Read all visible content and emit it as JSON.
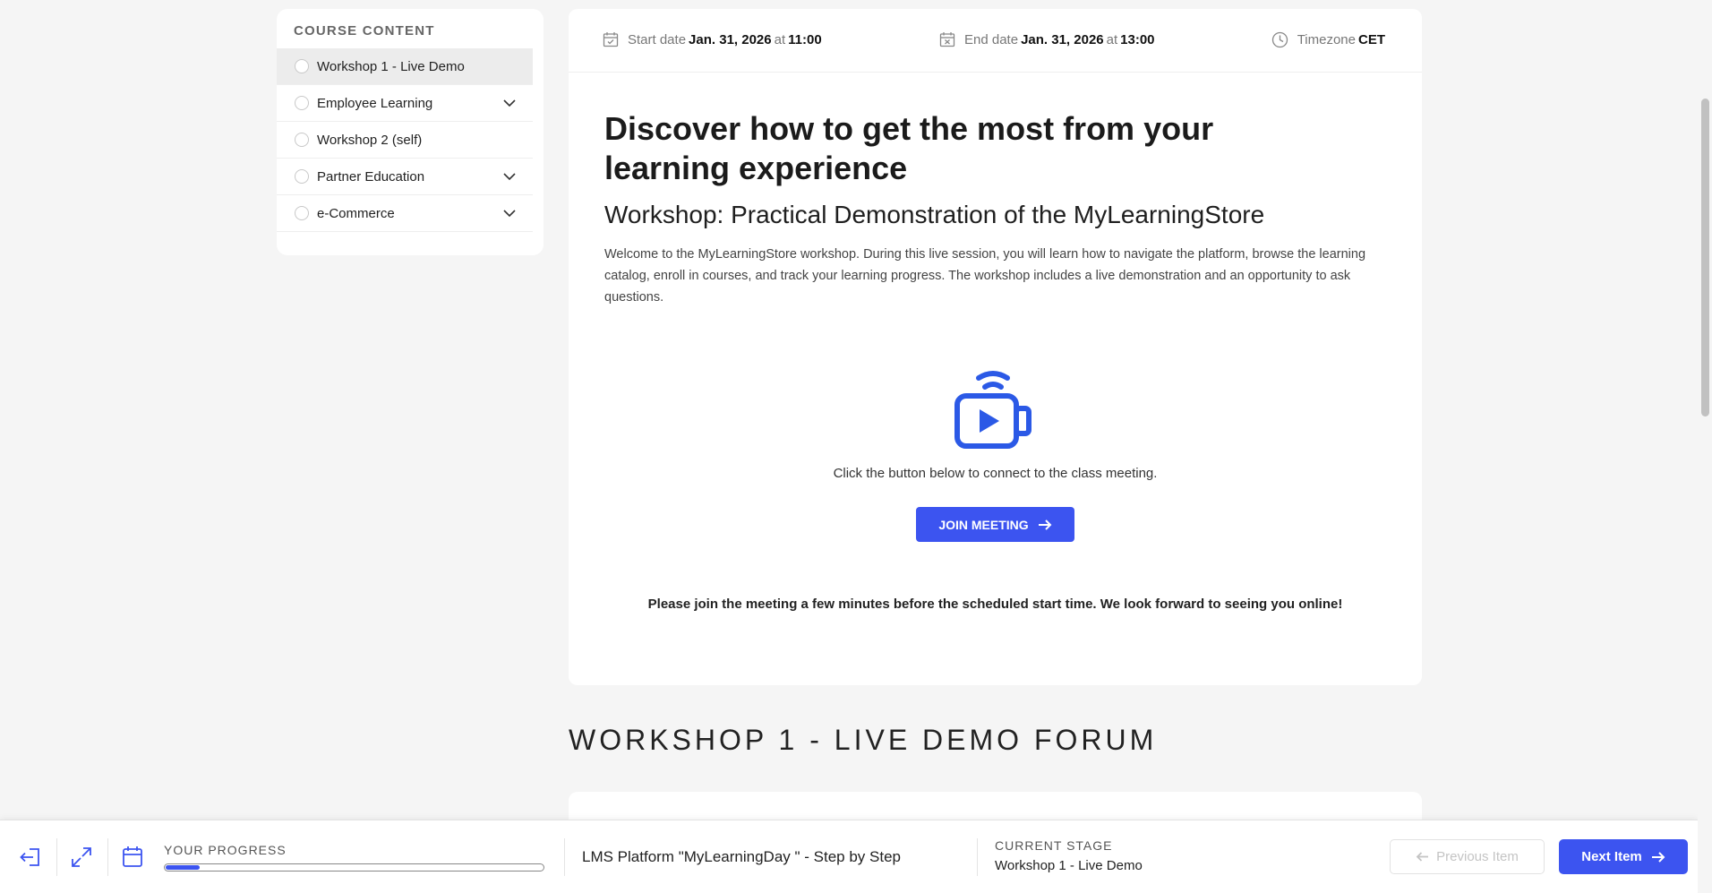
{
  "sidebar": {
    "title": "COURSE CONTENT",
    "items": [
      {
        "label": "Workshop 1 - Live Demo",
        "active": true,
        "expandable": false
      },
      {
        "label": "Employee Learning",
        "active": false,
        "expandable": true
      },
      {
        "label": "Workshop 2 (self)",
        "active": false,
        "expandable": false
      },
      {
        "label": "Partner Education",
        "active": false,
        "expandable": true
      },
      {
        "label": "e-Commerce",
        "active": false,
        "expandable": true
      }
    ]
  },
  "session": {
    "start_label": "Start date",
    "start_date": "Jan. 31, 2026",
    "start_at": "at",
    "start_time": "11:00",
    "end_label": "End date",
    "end_date": "Jan. 31, 2026",
    "end_at": "at",
    "end_time": "13:00",
    "tz_label": "Timezone",
    "tz_value": "CET"
  },
  "content": {
    "title": "Discover how to get the most from your learning experience",
    "subtitle": "Workshop: Practical Demonstration of the MyLearningStore",
    "description": "Welcome to the MyLearningStore workshop. During this live session, you will learn how to navigate the platform, browse the learning catalog, enroll in courses, and track your learning progress. The workshop includes a live demonstration and an opportunity to ask questions.",
    "connect_text": "Click the button below to connect to the class meeting.",
    "join_button": "JOIN MEETING",
    "join_note": "Please join the meeting a few minutes before the scheduled start time. We look forward to seeing you online!"
  },
  "forum": {
    "title": "WORKSHOP 1 - LIVE DEMO FORUM"
  },
  "bottombar": {
    "progress_label": "YOUR PROGRESS",
    "progress_fraction": 0.09,
    "course_name": "LMS Platform \"MyLearningDay \" - Step by Step",
    "stage_label": "CURRENT STAGE",
    "stage_value": "Workshop 1 - Live Demo",
    "prev_label": "Previous Item",
    "next_label": "Next Item"
  },
  "colors": {
    "accent": "#3c54f0",
    "background": "#f5f5f5"
  }
}
